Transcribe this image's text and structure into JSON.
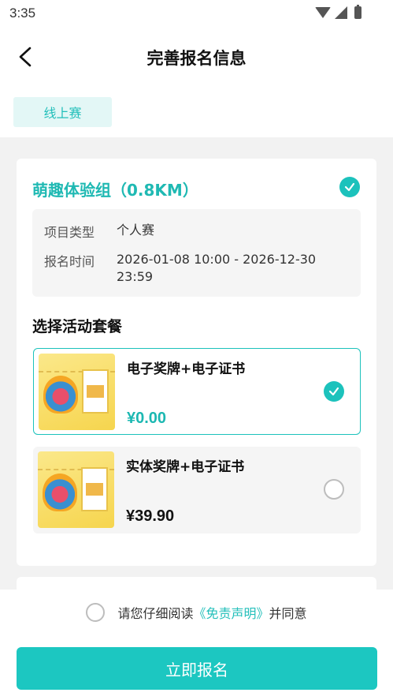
{
  "status_bar": {
    "time": "3:35"
  },
  "header": {
    "title": "完善报名信息"
  },
  "tab": {
    "label": "线上赛"
  },
  "group": {
    "title": "萌趣体验组（0.8KM）",
    "info": [
      {
        "label": "项目类型",
        "value": "个人赛"
      },
      {
        "label": "报名时间",
        "value": "2026-01-08 10:00 - 2026-12-30 23:59"
      }
    ]
  },
  "packages_section": {
    "title": "选择活动套餐",
    "items": [
      {
        "name": "电子奖牌+电子证书",
        "price": "¥0.00",
        "selected": true
      },
      {
        "name": "实体奖牌+电子证书",
        "price": "¥39.90",
        "selected": false
      }
    ]
  },
  "agreement": {
    "prefix": "请您仔细阅读",
    "link": "《免责声明》",
    "suffix": "并同意"
  },
  "submit": {
    "label": "立即报名"
  },
  "colors": {
    "accent": "#1cc2bc",
    "accent_light": "#e3f7f6"
  },
  "icons": {
    "back": "chevron-left-icon",
    "check": "check-circle-icon",
    "radio": "radio-unchecked-icon"
  }
}
